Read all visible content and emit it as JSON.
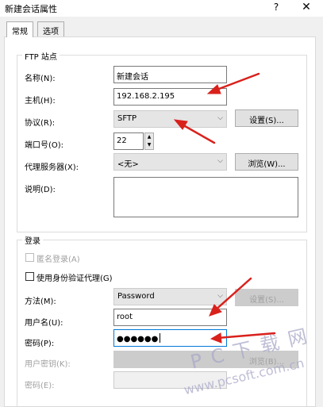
{
  "window": {
    "title": "新建会话属性",
    "help_label": "?",
    "close_label": "✕"
  },
  "tabs": [
    {
      "label": "常规",
      "active": true
    },
    {
      "label": "选项",
      "active": false
    }
  ],
  "ftp_group": {
    "title": "FTP 站点",
    "name": {
      "label": "名称(N):",
      "value": "新建会话"
    },
    "host": {
      "label": "主机(H):",
      "value": "192.168.2.195"
    },
    "protocol": {
      "label": "协议(R):",
      "value": "SFTP",
      "button": "设置(S)..."
    },
    "port": {
      "label": "端口号(O):",
      "value": "22"
    },
    "proxy": {
      "label": "代理服务器(X):",
      "value": "<无>",
      "button": "浏览(W)..."
    },
    "description": {
      "label": "说明(D):",
      "value": ""
    }
  },
  "login_group": {
    "title": "登录",
    "anonymous": {
      "label": "匿名登录(A)",
      "checked": false
    },
    "auth_agent": {
      "label": "使用身份验证代理(G)",
      "checked": false
    },
    "method": {
      "label": "方法(M):",
      "value": "Password",
      "button": "设置(S)..."
    },
    "username": {
      "label": "用户名(U):",
      "value": "root"
    },
    "password": {
      "label": "密码(P):",
      "value": "●●●●●●"
    },
    "user_key": {
      "label": "用户密钥(K):",
      "button": "浏览(B)..."
    },
    "passphrase": {
      "label": "密码(E):",
      "value": ""
    }
  },
  "watermark": {
    "line1": "P C 下 载 网",
    "line2": "www.pcsoft.com.cn"
  },
  "colors": {
    "annotation_arrow": "#d9211c",
    "focus": "#0078d7"
  }
}
